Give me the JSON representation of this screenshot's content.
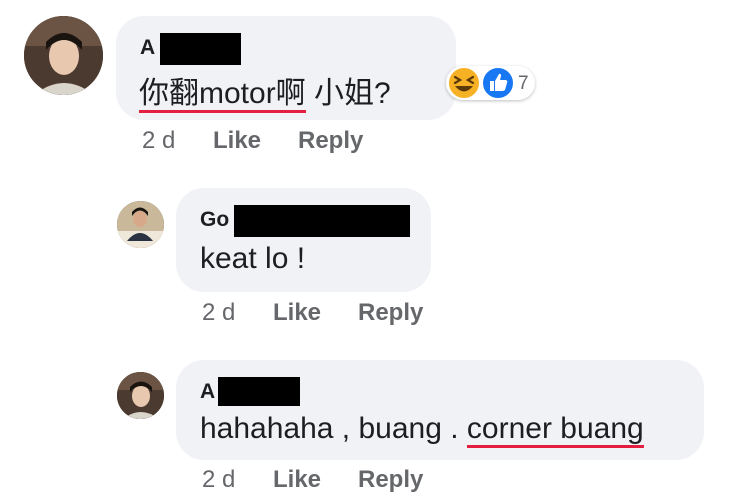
{
  "colors": {
    "bubble": "#f0f2f5",
    "underline": "#e41e3f",
    "meta_text": "#65676b",
    "like_blue": "#1877f2",
    "haha_yellow": "#f7b125"
  },
  "comments": [
    {
      "author": "A",
      "text_underlined": "你翻motor啊",
      "text_rest": " 小姐?",
      "time": "2 d",
      "like_label": "Like",
      "reply_label": "Reply",
      "reactions": {
        "icons": [
          "haha-icon",
          "like-icon"
        ],
        "count": "7"
      }
    },
    {
      "author": "Go",
      "text": "keat lo !",
      "time": "2 d",
      "like_label": "Like",
      "reply_label": "Reply"
    },
    {
      "author": "A",
      "text_plain": "hahahaha , buang . ",
      "text_underlined": "corner buang",
      "time": "2 d",
      "like_label": "Like",
      "reply_label": "Reply"
    }
  ]
}
